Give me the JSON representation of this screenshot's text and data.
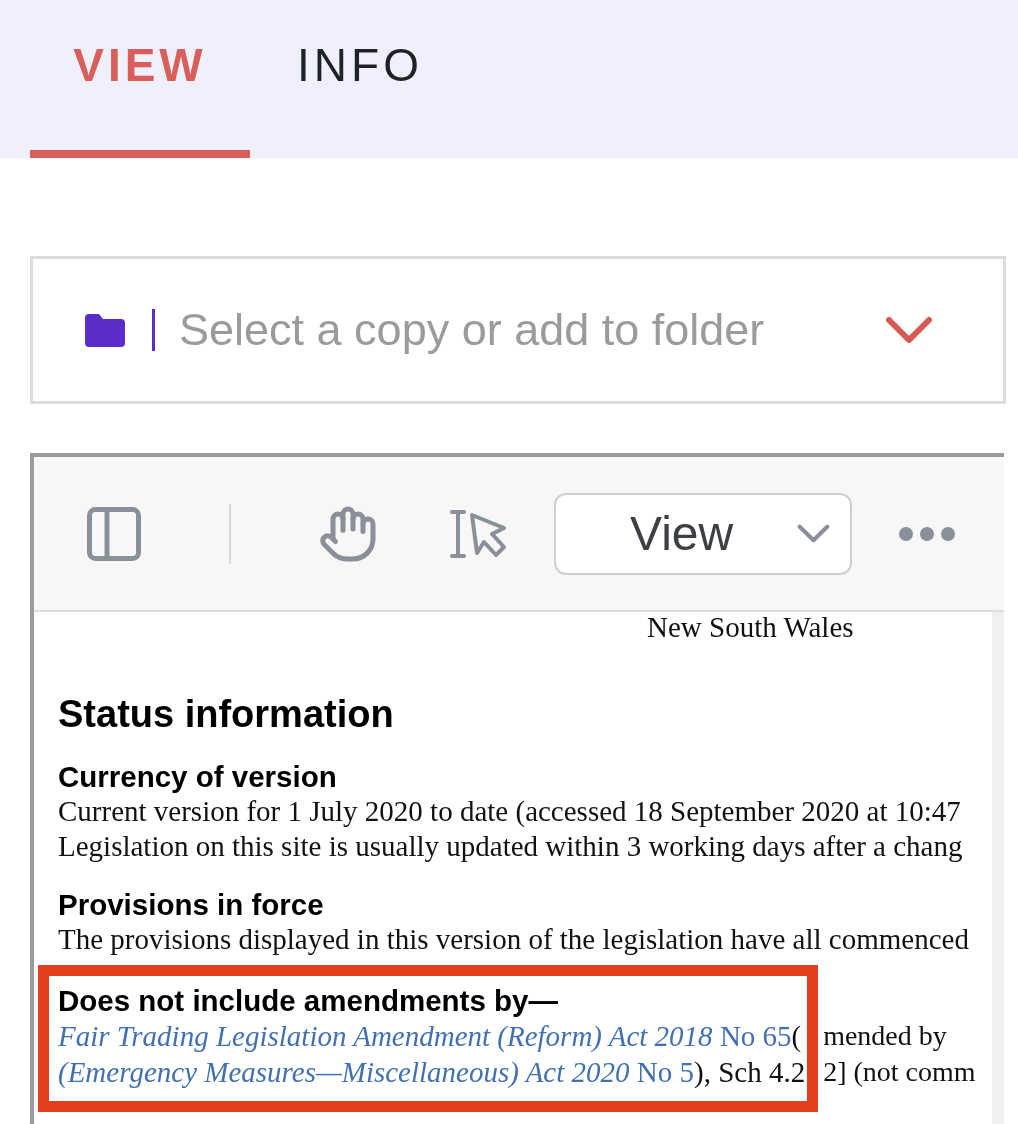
{
  "tabs": [
    {
      "label": "VIEW",
      "selected": true
    },
    {
      "label": "INFO",
      "selected": false
    }
  ],
  "folder_select": {
    "placeholder": "Select a copy or add to folder"
  },
  "viewer": {
    "view_menu": {
      "label": "View"
    },
    "document": {
      "jurisdiction": "New South Wales",
      "title": "Status information",
      "sections": [
        {
          "heading": "Currency of version",
          "lines": [
            "Current version for 1 July 2020 to date (accessed 18 September 2020 at 10:47",
            "Legislation on this site is usually updated within 3 working days after a chang"
          ]
        },
        {
          "heading": "Provisions in force",
          "lines": [
            "The provisions displayed in this version of the legislation have all commenced"
          ]
        }
      ],
      "highlighted": {
        "heading": "Does not include amendments by—",
        "lines": [
          {
            "link": "*Fair Trading Legislation Amendment (Reform) Act 2018* No 65",
            "text": "("
          },
          {
            "link": "*(Emergency Measures—Miscellaneous) Act 2020* No 5",
            "text": "), Sch 4.2"
          }
        ],
        "text_past_frame": [
          "mended by",
          "2] (not comm"
        ]
      }
    }
  }
}
